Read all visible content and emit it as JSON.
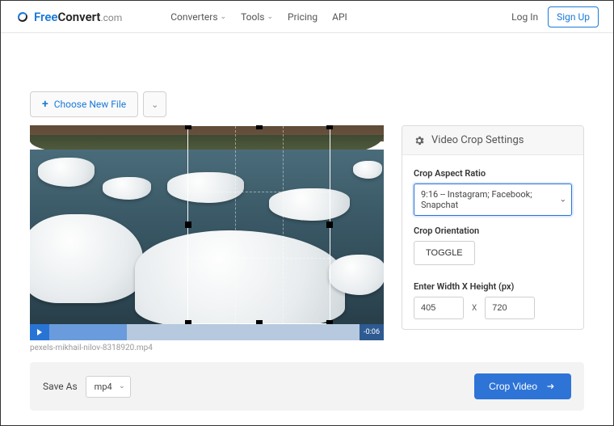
{
  "header": {
    "logo_free": "Free",
    "logo_convert": "Convert",
    "logo_com": ".com",
    "nav": [
      {
        "label": "Converters"
      },
      {
        "label": "Tools"
      },
      {
        "label": "Pricing"
      },
      {
        "label": "API"
      }
    ],
    "login": "Log In",
    "signup": "Sign Up"
  },
  "toolbar": {
    "choose_new_file": "Choose New File"
  },
  "video": {
    "filename": "pexels-mikhail-nilov-8318920.mp4",
    "time_remaining": "-0:06"
  },
  "settings": {
    "title": "Video Crop Settings",
    "aspect_label": "Crop Aspect Ratio",
    "aspect_value": "9:16 -- Instagram; Facebook; Snapchat",
    "orientation_label": "Crop Orientation",
    "toggle_label": "TOGGLE",
    "wh_label": "Enter Width X Height (px)",
    "width": "405",
    "height": "720",
    "x_sep": "X"
  },
  "footer": {
    "save_as_label": "Save As",
    "format": "mp4",
    "crop_button": "Crop Video"
  }
}
